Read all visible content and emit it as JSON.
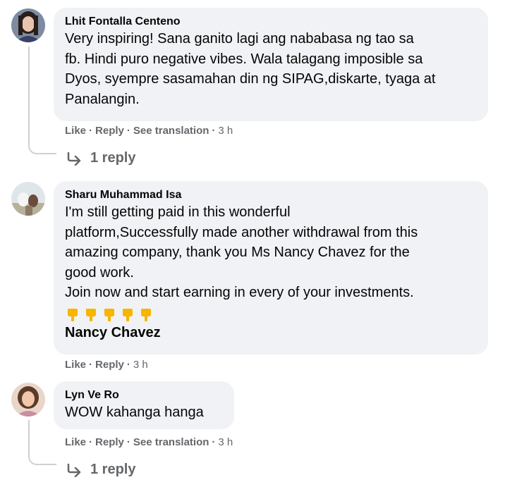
{
  "comments": [
    {
      "author": "Lhit Fontalla Centeno",
      "text": "Very inspiring! Sana ganito lagi ang nababasa ng tao sa\nfb. Hindi puro negative vibes. Wala talagang imposible sa\nDyos, syempre sasamahan din ng SIPAG,diskarte, tyaga at\nPanalangin.",
      "like": "Like",
      "reply": "Reply",
      "see_translation": "See translation",
      "time": "3 h",
      "replies_link": "1 reply",
      "avatar_icon": "profile-photo-woman"
    },
    {
      "author": "Sharu Muhammad Isa",
      "text": "I'm still getting paid in this wonderful\nplatform,Successfully made another withdrawal from this\namazing company, thank you Ms Nancy Chavez for the\ngood work.\nJoin now and start earning in every of your investments.",
      "emoji": "👇👇👇👇👇",
      "mention": "Nancy Chavez",
      "like": "Like",
      "reply": "Reply",
      "time": "3 h",
      "avatar_icon": "profile-photo-animals"
    },
    {
      "author": "Lyn Ve Ro",
      "text": "WOW kahanga hanga",
      "like": "Like",
      "reply": "Reply",
      "see_translation": "See translation",
      "time": "3 h",
      "replies_link": "1 reply",
      "avatar_icon": "profile-photo-woman"
    }
  ],
  "colors": {
    "bubble": "#f0f2f5",
    "meta_text": "#65676b",
    "text": "#050505",
    "emoji": "#f7b500"
  }
}
